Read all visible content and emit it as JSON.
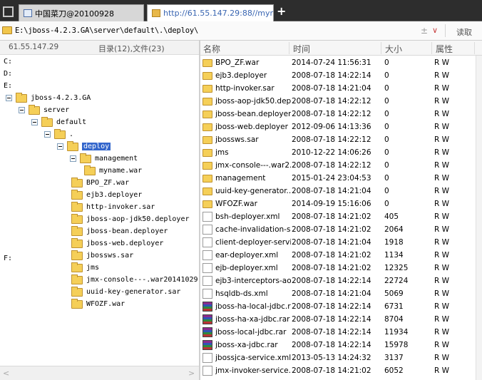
{
  "tabs": [
    {
      "label": "中国菜刀@20100928"
    },
    {
      "label": "http://61.55.147.29:88//myn..."
    }
  ],
  "address": {
    "path": "E:\\jboss-4.2.3.GA\\server\\default\\.\\deploy\\",
    "read_label": "读取"
  },
  "left_header": {
    "ip": "61.55.147.29",
    "stats": "目录(12),文件(23)"
  },
  "columns": {
    "name": "名称",
    "time": "时间",
    "size": "大小",
    "attr": "属性"
  },
  "drives": [
    "C:",
    "D:",
    "E:",
    "F:"
  ],
  "tree": [
    {
      "label": "jboss-4.2.3.GA",
      "level": 0,
      "toggle": true
    },
    {
      "label": "server",
      "level": 1,
      "toggle": true
    },
    {
      "label": "default",
      "level": 2,
      "toggle": true
    },
    {
      "label": ".",
      "level": 3,
      "toggle": true
    },
    {
      "label": "deploy",
      "level": 4,
      "toggle": true,
      "selected": true
    },
    {
      "label": "management",
      "level": 5,
      "toggle": true
    },
    {
      "label": "myname.war",
      "level": 6,
      "toggle": false
    },
    {
      "label": "BPO_ZF.war",
      "level": 5,
      "toggle": false
    },
    {
      "label": "ejb3.deployer",
      "level": 5,
      "toggle": false
    },
    {
      "label": "http-invoker.sar",
      "level": 5,
      "toggle": false
    },
    {
      "label": "jboss-aop-jdk50.deployer",
      "level": 5,
      "toggle": false
    },
    {
      "label": "jboss-bean.deployer",
      "level": 5,
      "toggle": false
    },
    {
      "label": "jboss-web.deployer",
      "level": 5,
      "toggle": false
    },
    {
      "label": "jbossws.sar",
      "level": 5,
      "toggle": false
    },
    {
      "label": "jms",
      "level": 5,
      "toggle": false
    },
    {
      "label": "jmx-console---.war20141029",
      "level": 5,
      "toggle": false
    },
    {
      "label": "uuid-key-generator.sar",
      "level": 5,
      "toggle": false
    },
    {
      "label": "WFOZF.war",
      "level": 5,
      "toggle": false
    }
  ],
  "files": [
    {
      "name": "BPO_ZF.war",
      "time": "2014-07-24 11:56:31",
      "size": "0",
      "attr": "R W",
      "icon": "folder-icon"
    },
    {
      "name": "ejb3.deployer",
      "time": "2008-07-18 14:22:14",
      "size": "0",
      "attr": "R W",
      "icon": "folder-icon"
    },
    {
      "name": "http-invoker.sar",
      "time": "2008-07-18 14:21:04",
      "size": "0",
      "attr": "R W",
      "icon": "folder-icon"
    },
    {
      "name": "jboss-aop-jdk50.dep...",
      "time": "2008-07-18 14:22:12",
      "size": "0",
      "attr": "R W",
      "icon": "folder-icon"
    },
    {
      "name": "jboss-bean.deployer",
      "time": "2008-07-18 14:22:12",
      "size": "0",
      "attr": "R W",
      "icon": "folder-icon"
    },
    {
      "name": "jboss-web.deployer",
      "time": "2012-09-06 14:13:36",
      "size": "0",
      "attr": "R W",
      "icon": "folder-icon"
    },
    {
      "name": "jbossws.sar",
      "time": "2008-07-18 14:22:12",
      "size": "0",
      "attr": "R W",
      "icon": "folder-icon"
    },
    {
      "name": "jms",
      "time": "2010-12-22 14:06:26",
      "size": "0",
      "attr": "R W",
      "icon": "folder-icon"
    },
    {
      "name": "jmx-console---.war2...",
      "time": "2008-07-18 14:22:12",
      "size": "0",
      "attr": "R W",
      "icon": "folder-icon"
    },
    {
      "name": "management",
      "time": "2015-01-24 23:04:53",
      "size": "0",
      "attr": "R W",
      "icon": "folder-icon"
    },
    {
      "name": "uuid-key-generator....",
      "time": "2008-07-18 14:21:04",
      "size": "0",
      "attr": "R W",
      "icon": "folder-icon"
    },
    {
      "name": "WFOZF.war",
      "time": "2014-09-19 15:16:06",
      "size": "0",
      "attr": "R W",
      "icon": "folder-icon"
    },
    {
      "name": "bsh-deployer.xml",
      "time": "2008-07-18 14:21:02",
      "size": "405",
      "attr": "R W",
      "icon": "file-icon"
    },
    {
      "name": "cache-invalidation-s...",
      "time": "2008-07-18 14:21:02",
      "size": "2064",
      "attr": "R W",
      "icon": "file-icon"
    },
    {
      "name": "client-deployer-servi...",
      "time": "2008-07-18 14:21:04",
      "size": "1918",
      "attr": "R W",
      "icon": "file-icon"
    },
    {
      "name": "ear-deployer.xml",
      "time": "2008-07-18 14:21:02",
      "size": "1134",
      "attr": "R W",
      "icon": "file-icon"
    },
    {
      "name": "ejb-deployer.xml",
      "time": "2008-07-18 14:21:02",
      "size": "12325",
      "attr": "R W",
      "icon": "file-icon"
    },
    {
      "name": "ejb3-interceptors-ao...",
      "time": "2008-07-18 14:22:14",
      "size": "22724",
      "attr": "R W",
      "icon": "file-icon"
    },
    {
      "name": "hsqldb-ds.xml",
      "time": "2008-07-18 14:21:04",
      "size": "5069",
      "attr": "R W",
      "icon": "file-icon"
    },
    {
      "name": "jboss-ha-local-jdbc.rar",
      "time": "2008-07-18 14:22:14",
      "size": "6731",
      "attr": "R W",
      "icon": "rar-icon"
    },
    {
      "name": "jboss-ha-xa-jdbc.rar",
      "time": "2008-07-18 14:22:14",
      "size": "8704",
      "attr": "R W",
      "icon": "rar-icon"
    },
    {
      "name": "jboss-local-jdbc.rar",
      "time": "2008-07-18 14:22:14",
      "size": "11934",
      "attr": "R W",
      "icon": "rar-icon"
    },
    {
      "name": "jboss-xa-jdbc.rar",
      "time": "2008-07-18 14:22:14",
      "size": "15978",
      "attr": "R W",
      "icon": "rar-icon"
    },
    {
      "name": "jbossjca-service.xml",
      "time": "2013-05-13 14:24:32",
      "size": "3137",
      "attr": "R W",
      "icon": "file-icon"
    },
    {
      "name": "jmx-invoker-service....",
      "time": "2008-07-18 14:21:02",
      "size": "6052",
      "attr": "R W",
      "icon": "file-icon"
    }
  ]
}
